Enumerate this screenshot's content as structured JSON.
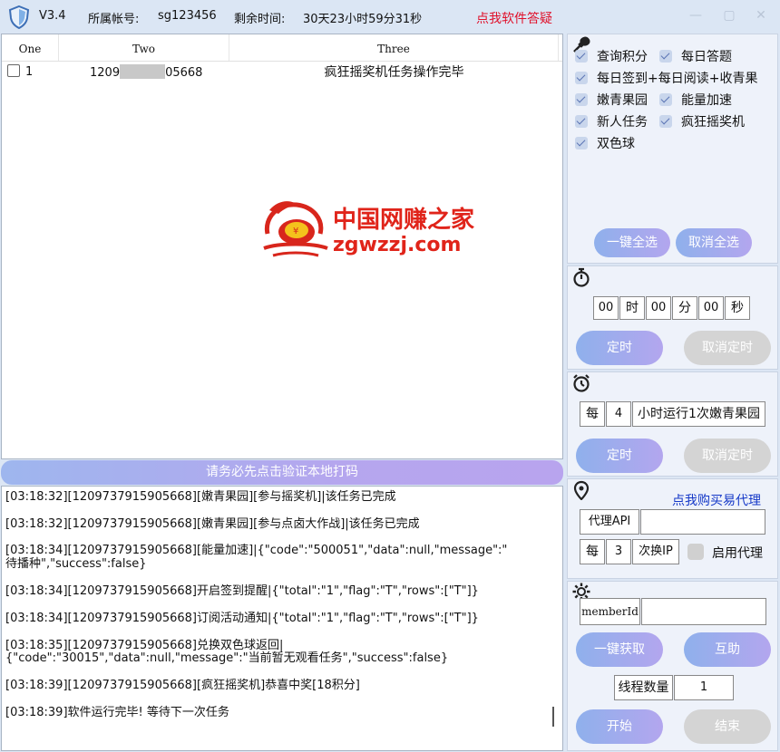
{
  "titlebar": {
    "version": "V3.4",
    "account_label": "所属帐号:",
    "account_value": "sg123456",
    "remaining_label": "剩余时间:",
    "remaining_value": "30天23小时59分31秒",
    "help_link": "点我软件答疑"
  },
  "table": {
    "columns": [
      "One",
      "Two",
      "Three"
    ],
    "rows": [
      {
        "one": "1",
        "two_prefix": "1209",
        "two_suffix": "05668",
        "three": "疯狂摇奖机任务操作完毕"
      }
    ]
  },
  "watermark": {
    "line1": "中国网赚之家",
    "line2": "zgwzzj.com"
  },
  "banner": "请务必先点击验证本地打码",
  "log": [
    "[03:18:32][1209737915905668][嫩青果园][参与摇奖机]|该任务已完成",
    "[03:18:32][1209737915905668][嫩青果园][参与点卤大作战]|该任务已完成",
    "[03:18:34][1209737915905668][能量加速]|{\"code\":\"500051\",\"data\":null,\"message\":\"",
    "待播种\",\"success\":false}",
    "[03:18:34][1209737915905668]开启签到提醒|{\"total\":\"1\",\"flag\":\"T\",\"rows\":[\"T\"]}",
    "[03:18:34][1209737915905668]订阅活动通知|{\"total\":\"1\",\"flag\":\"T\",\"rows\":[\"T\"]}",
    "[03:18:35][1209737915905668]兑换双色球返回|",
    "{\"code\":\"30015\",\"data\":null,\"message\":\"当前暂无观看任务\",\"success\":false}",
    "[03:18:39][1209737915905668][疯狂摇奖机]恭喜中奖[18积分]",
    "[03:18:39]软件运行完毕! 等待下一次任务"
  ],
  "tasks": {
    "items": [
      "查询积分",
      "每日答题",
      "每日签到+每日阅读+收青果",
      "嫩青果园",
      "能量加速",
      "新人任务",
      "疯狂摇奖机",
      "双色球"
    ],
    "select_all": "一键全选",
    "deselect_all": "取消全选"
  },
  "timer": {
    "hours": "00",
    "hours_unit": "时",
    "minutes": "00",
    "minutes_unit": "分",
    "seconds": "00",
    "seconds_unit": "秒",
    "start": "定时",
    "cancel": "取消定时"
  },
  "interval": {
    "prefix": "每",
    "value": "4",
    "suffix": "小时运行1次嫩青果园",
    "start": "定时",
    "cancel": "取消定时"
  },
  "proxy": {
    "buy_link": "点我购买易代理",
    "api_label": "代理API",
    "api_value": "",
    "every_prefix": "每",
    "every_value": "3",
    "every_suffix": "次换IP",
    "enable_label": "启用代理"
  },
  "settings": {
    "member_label": "memberId",
    "member_value": "",
    "fetch": "一键获取",
    "mutual": "互助",
    "threads_label": "线程数量",
    "threads_value": "1",
    "start": "开始",
    "stop": "结束"
  }
}
